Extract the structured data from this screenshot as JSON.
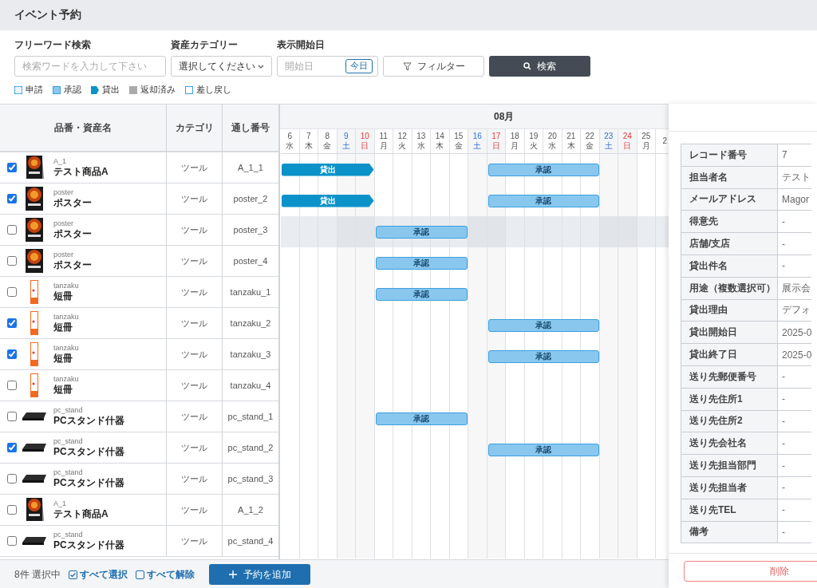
{
  "page": {
    "title": "イベント予約"
  },
  "filters": [
    {
      "label": "フリーワード検索",
      "kind": "text",
      "placeholder": "検索ワードを入力して下さい"
    },
    {
      "label": "資産カテゴリー",
      "kind": "select",
      "value": "選択してください"
    },
    {
      "label": "表示開始日",
      "kind": "date",
      "placeholder": "開始日",
      "button": "今日"
    }
  ],
  "filter_button": "フィルター",
  "search_button": "検索",
  "legend": [
    {
      "label": "申請",
      "kind": "applied"
    },
    {
      "label": "承認",
      "kind": "approved"
    },
    {
      "label": "貸出",
      "kind": "lend"
    },
    {
      "label": "返却済み",
      "kind": "returned"
    },
    {
      "label": "差し戻し",
      "kind": "rejected"
    }
  ],
  "table": {
    "columns": [
      "品番・資産名",
      "カテゴリ",
      "通し番号"
    ],
    "rows": [
      {
        "checked": true,
        "kind": "tabletop",
        "code": "A_1",
        "name": "テスト商品A",
        "category": "ツール",
        "serial": "A_1_1",
        "highlighted": false,
        "bars": [
          {
            "label": "貸出",
            "kind": "lend"
          },
          {
            "label": "承認",
            "kind": "approved"
          }
        ],
        "booked": [
          true,
          true,
          true,
          true,
          true,
          false,
          false,
          false,
          false,
          false,
          false,
          true,
          true,
          true,
          true,
          true,
          true,
          false,
          false,
          false,
          false
        ]
      },
      {
        "checked": true,
        "kind": "poster",
        "code": "poster",
        "name": "ポスター",
        "category": "ツール",
        "serial": "poster_2",
        "highlighted": false,
        "bars": [
          {
            "label": "貸出",
            "kind": "lend"
          },
          {
            "label": "承認",
            "kind": "approved"
          }
        ],
        "booked": [
          true,
          true,
          true,
          true,
          true,
          false,
          false,
          false,
          false,
          false,
          false,
          true,
          true,
          true,
          true,
          true,
          true,
          false,
          false,
          false,
          false
        ]
      },
      {
        "checked": false,
        "kind": "poster",
        "code": "poster",
        "name": "ポスター",
        "category": "ツール",
        "serial": "poster_3",
        "highlighted": true,
        "bars": [
          {
            "label": "承認",
            "kind": "approved"
          }
        ],
        "booked": [
          false,
          false,
          false,
          false,
          false,
          true,
          true,
          true,
          true,
          true,
          false,
          false,
          false,
          false,
          false,
          false,
          false,
          false,
          false,
          false,
          false
        ]
      },
      {
        "checked": false,
        "kind": "poster",
        "code": "poster",
        "name": "ポスター",
        "category": "ツール",
        "serial": "poster_4",
        "highlighted": false,
        "bars": [
          {
            "label": "承認",
            "kind": "approved"
          }
        ],
        "booked": [
          false,
          false,
          false,
          false,
          false,
          true,
          true,
          true,
          true,
          true,
          false,
          false,
          false,
          false,
          false,
          false,
          false,
          false,
          false,
          false,
          false
        ]
      },
      {
        "checked": false,
        "kind": "tanzaku",
        "code": "tanzaku",
        "name": "短冊",
        "category": "ツール",
        "serial": "tanzaku_1",
        "highlighted": false,
        "bars": [
          {
            "label": "承認",
            "kind": "approved"
          }
        ],
        "booked": [
          false,
          false,
          false,
          false,
          false,
          true,
          true,
          true,
          true,
          true,
          false,
          false,
          false,
          false,
          false,
          false,
          false,
          false,
          false,
          false,
          false
        ]
      },
      {
        "checked": true,
        "kind": "tanzaku",
        "code": "tanzaku",
        "name": "短冊",
        "category": "ツール",
        "serial": "tanzaku_2",
        "highlighted": false,
        "bars": [
          {
            "label": "承認",
            "kind": "approved"
          }
        ],
        "booked": [
          false,
          false,
          false,
          false,
          false,
          false,
          false,
          false,
          false,
          false,
          false,
          true,
          true,
          true,
          true,
          true,
          true,
          false,
          false,
          false,
          false
        ]
      },
      {
        "checked": true,
        "kind": "tanzaku",
        "code": "tanzaku",
        "name": "短冊",
        "category": "ツール",
        "serial": "tanzaku_3",
        "highlighted": false,
        "bars": [
          {
            "label": "承認",
            "kind": "approved"
          }
        ],
        "booked": [
          false,
          false,
          false,
          false,
          false,
          false,
          false,
          false,
          false,
          false,
          false,
          true,
          true,
          true,
          true,
          true,
          true,
          false,
          false,
          false,
          false
        ]
      },
      {
        "checked": false,
        "kind": "tanzaku",
        "code": "tanzaku",
        "name": "短冊",
        "category": "ツール",
        "serial": "tanzaku_4",
        "highlighted": false
      },
      {
        "checked": false,
        "kind": "stand",
        "code": "pc_stand",
        "name": "PCスタンド什器",
        "category": "ツール",
        "serial": "pc_stand_1",
        "highlighted": false,
        "bars": [
          {
            "label": "承認",
            "kind": "approved"
          }
        ],
        "booked": [
          false,
          false,
          false,
          false,
          false,
          true,
          true,
          true,
          true,
          true,
          false,
          false,
          false,
          false,
          false,
          false,
          false,
          false,
          false,
          false,
          false
        ]
      },
      {
        "checked": true,
        "kind": "stand",
        "code": "pc_stand",
        "name": "PCスタンド什器",
        "category": "ツール",
        "serial": "pc_stand_2",
        "highlighted": false,
        "bars": [
          {
            "label": "承認",
            "kind": "approved"
          }
        ],
        "booked": [
          false,
          false,
          false,
          false,
          false,
          false,
          false,
          false,
          false,
          false,
          false,
          true,
          true,
          true,
          true,
          true,
          true,
          false,
          false,
          false,
          false
        ]
      },
      {
        "checked": false,
        "kind": "stand",
        "code": "pc_stand",
        "name": "PCスタンド什器",
        "category": "ツール",
        "serial": "pc_stand_3",
        "highlighted": false
      },
      {
        "checked": false,
        "kind": "tabletop",
        "code": "A_1",
        "name": "テスト商品A",
        "category": "ツール",
        "serial": "A_1_2",
        "highlighted": false
      },
      {
        "checked": false,
        "kind": "stand",
        "code": "pc_stand",
        "name": "PCスタンド什器",
        "category": "ツール",
        "serial": "pc_stand_4",
        "highlighted": false
      }
    ]
  },
  "calendar": {
    "month": "08月",
    "days": [
      {
        "day": "6",
        "weekday": "水",
        "kind": "weekday"
      },
      {
        "day": "7",
        "weekday": "木",
        "kind": "weekday"
      },
      {
        "day": "8",
        "weekday": "金",
        "kind": "weekday"
      },
      {
        "day": "9",
        "weekday": "土",
        "kind": "saturday"
      },
      {
        "day": "10",
        "weekday": "日",
        "kind": "sunday"
      },
      {
        "day": "11",
        "weekday": "月",
        "kind": "weekday"
      },
      {
        "day": "12",
        "weekday": "火",
        "kind": "weekday"
      },
      {
        "day": "13",
        "weekday": "水",
        "kind": "weekday"
      },
      {
        "day": "14",
        "weekday": "木",
        "kind": "weekday"
      },
      {
        "day": "15",
        "weekday": "金",
        "kind": "weekday"
      },
      {
        "day": "16",
        "weekday": "土",
        "kind": "saturday"
      },
      {
        "day": "17",
        "weekday": "日",
        "kind": "sunday"
      },
      {
        "day": "18",
        "weekday": "月",
        "kind": "weekday"
      },
      {
        "day": "19",
        "weekday": "火",
        "kind": "weekday"
      },
      {
        "day": "20",
        "weekday": "水",
        "kind": "weekday"
      },
      {
        "day": "21",
        "weekday": "木",
        "kind": "weekday"
      },
      {
        "day": "22",
        "weekday": "金",
        "kind": "weekday"
      },
      {
        "day": "23",
        "weekday": "土",
        "kind": "saturday"
      },
      {
        "day": "24",
        "weekday": "日",
        "kind": "sunday"
      },
      {
        "day": "25",
        "weekday": "月",
        "kind": "weekday"
      },
      {
        "day": "2",
        "kind": "weekday"
      }
    ]
  },
  "detail": {
    "fields": [
      {
        "label": "レコード番号",
        "value": "7"
      },
      {
        "label": "担当者名",
        "value": "テスト"
      },
      {
        "label": "メールアドレス",
        "value": "Magor"
      },
      {
        "label": "得意先",
        "value": "-"
      },
      {
        "label": "店舗/支店",
        "value": "-"
      },
      {
        "label": "貸出件名",
        "value": "-"
      },
      {
        "label": "用途（複数選択可）",
        "value": "展示会"
      },
      {
        "label": "貸出理由",
        "value": "デフォ"
      },
      {
        "label": "貸出開始日",
        "value": "2025-0"
      },
      {
        "label": "貸出終了日",
        "value": "2025-0"
      },
      {
        "label": "送り先郵便番号",
        "value": "-"
      },
      {
        "label": "送り先住所1",
        "value": "-"
      },
      {
        "label": "送り先住所2",
        "value": "-"
      },
      {
        "label": "送り先会社名",
        "value": "-"
      },
      {
        "label": "送り先担当部門",
        "value": "-"
      },
      {
        "label": "送り先担当者",
        "value": "-"
      },
      {
        "label": "送り先TEL",
        "value": "-"
      },
      {
        "label": "備考",
        "value": "-"
      }
    ],
    "delete_button": "削除"
  },
  "footer": {
    "selection": "8件 選択中",
    "select_all": "すべて選択",
    "clear_all": "すべて解除",
    "add_button": "予約を追加"
  }
}
